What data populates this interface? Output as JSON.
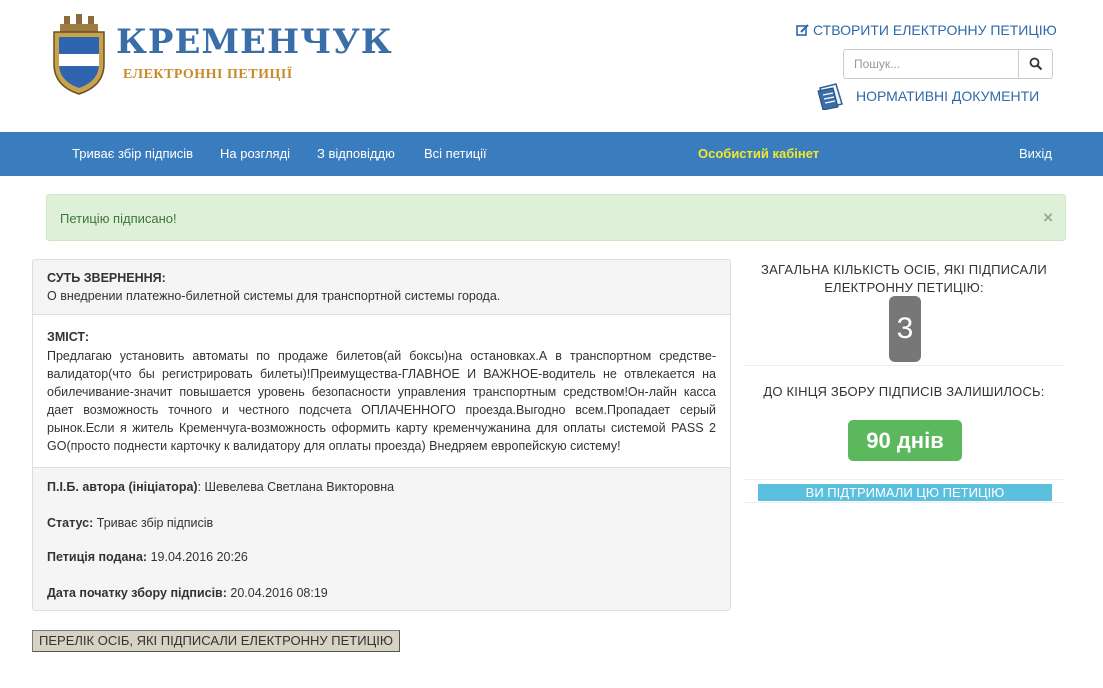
{
  "header": {
    "logo": {
      "title": "КРЕМЕНЧУК",
      "subtitle": "ЕЛЕКТРОННІ ПЕТИЦІЇ"
    },
    "create_petition_label": "СТВОРИТИ ЕЛЕКТРОННУ ПЕТИЦІЮ",
    "search": {
      "placeholder": "Пошук...",
      "value": ""
    },
    "normative_docs_label": "НОРМАТИВНІ ДОКУМЕНТИ"
  },
  "nav": {
    "items": [
      {
        "label": "Триває збір підписів"
      },
      {
        "label": "На розгляді"
      },
      {
        "label": "З відповіддю"
      },
      {
        "label": "Всі петиції"
      }
    ],
    "cabinet_label": "Особистий кабінет",
    "logout_label": "Вихід"
  },
  "alert": {
    "text": "Петицію підписано!",
    "close_symbol": "×"
  },
  "petition": {
    "essence_label": "СУТЬ ЗВЕРНЕННЯ:",
    "essence_text": "О внедрении платежно-билетной системы для транспортной системы города.",
    "content_label": "ЗМІСТ:",
    "content_text": "Предлагаю установить автоматы по продаже билетов(ай боксы)на остановках.А в транспортном средстве-валидатор(что бы регистрировать билеты)!Преимущества-ГЛАВНОЕ И ВАЖНОЕ-водитель не отвлекается на обилечивание-значит повышается уровень безопасности управления транспортным средством!Он-лайн касса дает возможность точного и честного подсчета ОПЛАЧЕННОГО проезда.Выгодно всем.Пропадает серый рынок.Если я житель Кременчуга-возможность оформить карту кременчужанина для оплаты системой PASS 2 GO(просто поднести карточку к валидатору для оплаты проезда) Внедряем европейскую систему!",
    "author_label": "П.І.Б. автора (ініціатора)",
    "author_value": "Шевелева Светлана Викторовна",
    "status_label": "Статус:",
    "status_value": "Триває збір підписів",
    "submitted_label": "Петиція подана:",
    "submitted_value": "19.04.2016 20:26",
    "start_label": "Дата початку збору підписів:",
    "start_value": "20.04.2016 08:19"
  },
  "signers_list_button": "ПЕРЕЛІК ОСІБ, ЯКІ ПІДПИСАЛИ ЕЛЕКТРОННУ ПЕТИЦІЮ",
  "sidebar": {
    "total_label_line1": "ЗАГАЛЬНА КІЛЬКІСТЬ ОСІБ, ЯКІ ПІДПИСАЛИ",
    "total_label_line2": "ЕЛЕКТРОННУ ПЕТИЦІЮ:",
    "total_count": "3",
    "remaining_label": "ДО КІНЦЯ ЗБОРУ ПІДПИСІВ ЗАЛИШИЛОСЬ:",
    "remaining_days": "90 днів",
    "supported_label": "ВИ ПІДТРИМАЛИ ЦЮ ПЕТИЦІЮ"
  },
  "colors": {
    "navbar": "#3a7dbf",
    "cabinet_link": "#f5e62b",
    "link_blue": "#2f6aa8",
    "alert_bg": "#dff0d8",
    "alert_text": "#3c763d",
    "count_badge": "#777777",
    "days_badge": "#5cb85c",
    "support_bar": "#5bc0de"
  }
}
